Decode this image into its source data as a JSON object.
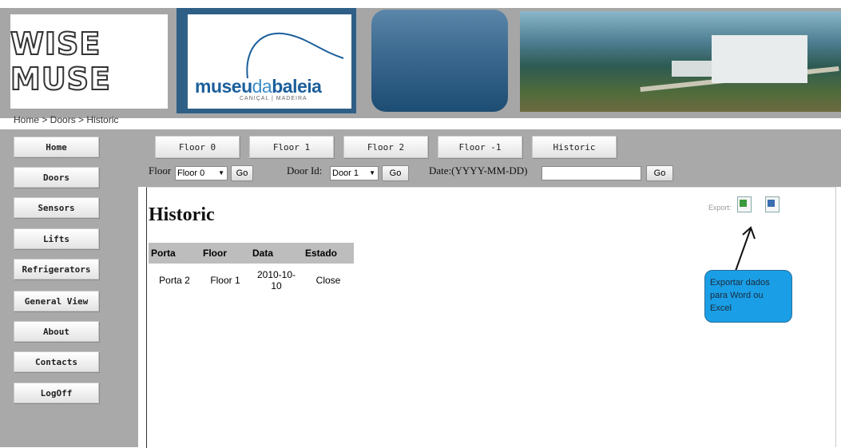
{
  "header": {
    "wise_logo": "WISE MUSE",
    "museu_logo": {
      "a": "museu",
      "b": "da",
      "c": "baleia"
    },
    "museu_subtitle": "CANIÇAL | MADEIRA"
  },
  "breadcrumb": "Home > Doors > Historic",
  "sidebar": {
    "items": [
      "Home",
      "Doors",
      "Sensors",
      "Lifts",
      "Refrigerators",
      "General View",
      "About",
      "Contacts",
      "LogOff"
    ]
  },
  "tabs": [
    "Floor 0",
    "Floor 1",
    "Floor 2",
    "Floor -1",
    "Historic"
  ],
  "filters": {
    "floor_label": "Floor",
    "floor_value": "Floor 0",
    "door_label": "Door Id:",
    "door_value": "Door 1",
    "date_label": "Date:(YYYY-MM-DD)",
    "date_value": "",
    "go": "Go"
  },
  "main": {
    "title": "Historic",
    "export_label": "Export:",
    "callout": "Exportar dados para Word ou Excel",
    "table": {
      "headers": [
        "Porta",
        "Floor",
        "Data",
        "Estado"
      ],
      "rows": [
        [
          "Porta 2",
          "Floor 1",
          "2010-10-10",
          "Close"
        ]
      ]
    }
  },
  "colors": {
    "sidebar_bg": "#a9a9a9",
    "callout_bg": "#1a9ee6",
    "brand_blue": "#1b5f9c"
  }
}
